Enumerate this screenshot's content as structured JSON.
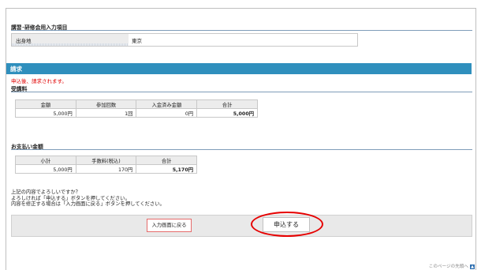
{
  "seminar_section": {
    "title": "講習･研修会用入力項目",
    "field_label": "出身地",
    "field_value": "東京"
  },
  "billing_section": {
    "band_title": "請求",
    "notice": "申込後、請求されます。",
    "fee_title": "受講料",
    "fee_table": {
      "headers": [
        "金額",
        "参加回数",
        "入金済み金額",
        "合計"
      ],
      "values": [
        "5,000円",
        "1回",
        "0円",
        "5,000円"
      ]
    }
  },
  "payment_section": {
    "title": "お支払い金額",
    "table": {
      "headers": [
        "小計",
        "手数料(税込)",
        "合計"
      ],
      "values": [
        "5,000円",
        "170円",
        "5,170円"
      ]
    }
  },
  "confirm_message": {
    "line1": "上記の内容でよろしいですか？",
    "line2": "よろしければ「申込する」ボタンを押してください。",
    "line3": "内容を修正する場合は「入力画面に戻る」ボタンを押してください。"
  },
  "buttons": {
    "back": "入力画面に戻る",
    "apply": "申込する"
  },
  "footer": {
    "page_top": "このページの先頭へ"
  }
}
